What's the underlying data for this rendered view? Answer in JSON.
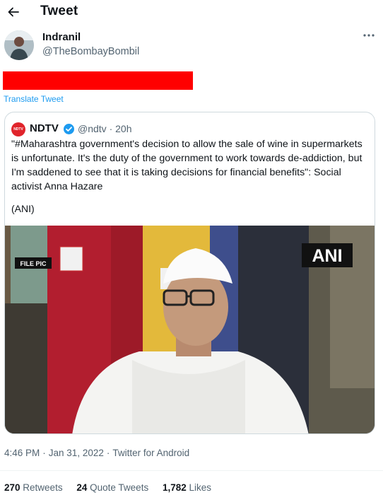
{
  "header": {
    "title": "Tweet",
    "back_icon": "arrow-left-icon"
  },
  "author": {
    "name": "Indranil",
    "handle": "@TheBombayBombil"
  },
  "translate_label": "Translate Tweet",
  "quote": {
    "logo_text": "NDTV",
    "name": "NDTV",
    "handle": "@ndtv",
    "time": "20h",
    "text": "\"#Maharashtra government's decision to allow the sale of wine in supermarkets is unfortunate. It's the duty of the government to work towards de-addiction, but I'm saddened to see that it is taking decisions for financial benefits\": Social activist Anna Hazare",
    "source": "(ANI)",
    "photo": {
      "left_tag": "FILE PIC",
      "right_tag": "ANI"
    }
  },
  "meta": {
    "time": "4:46 PM",
    "date": "Jan 31, 2022",
    "client": "Twitter for Android",
    "separator": "·"
  },
  "stats": {
    "retweets": {
      "count": "270",
      "label": "Retweets"
    },
    "quotes": {
      "count": "24",
      "label": "Quote Tweets"
    },
    "likes": {
      "count": "1,782",
      "label": "Likes"
    }
  },
  "colors": {
    "link": "#1d9bf0",
    "redaction": "#ff0000",
    "ndtv_red": "#e0242b",
    "verified": "#1d9bf0"
  }
}
